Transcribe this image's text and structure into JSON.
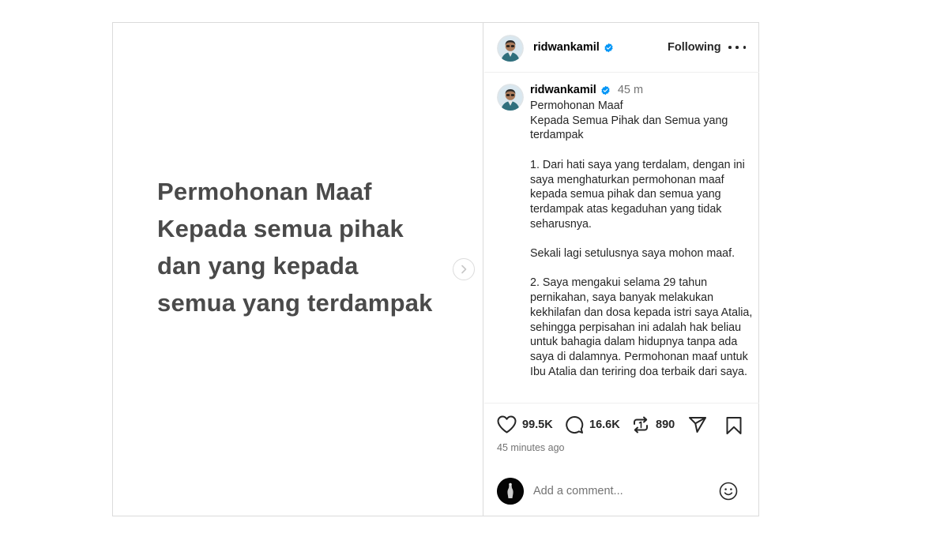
{
  "media": {
    "lines": [
      "Permohonan Maaf",
      "Kepada semua pihak",
      "dan yang kepada",
      "semua yang terdampak"
    ],
    "text_color": "#4a4a4a"
  },
  "header": {
    "username": "ridwankamil",
    "follow_label": "Following"
  },
  "caption": {
    "username": "ridwankamil",
    "time": "45 m",
    "text": "Permohonan Maaf\nKepada Semua Pihak dan Semua yang terdampak\n\n1. Dari hati saya yang terdalam, dengan ini saya menghaturkan permohonan maaf kepada semua pihak dan semua yang terdampak atas kegaduhan yang tidak seharusnya.\n\nSekali lagi setulusnya saya mohon maaf.\n\n2. Saya mengakui selama 29 tahun pernikahan, saya banyak melakukan kekhilafan dan dosa kepada istri saya Atalia, sehingga perpisahan ini adalah hak beliau untuk bahagia dalam hidupnya tanpa ada saya di dalamnya. Permohonan maaf untuk Ibu Atalia dan teriring doa terbaik dari saya."
  },
  "actions": {
    "likes": "99.5K",
    "comments": "16.6K",
    "reposts": "890"
  },
  "timestamp": "45 minutes ago",
  "comment_box": {
    "placeholder": "Add a comment..."
  },
  "colors": {
    "verified": "#0095f6",
    "border": "#dbdbdb",
    "secondary_text": "#737373"
  },
  "icons": [
    "chevron-right-icon",
    "verified-badge-icon",
    "more-icon",
    "heart-icon",
    "comment-icon",
    "repost-icon",
    "share-icon",
    "bookmark-icon",
    "emoji-icon"
  ]
}
